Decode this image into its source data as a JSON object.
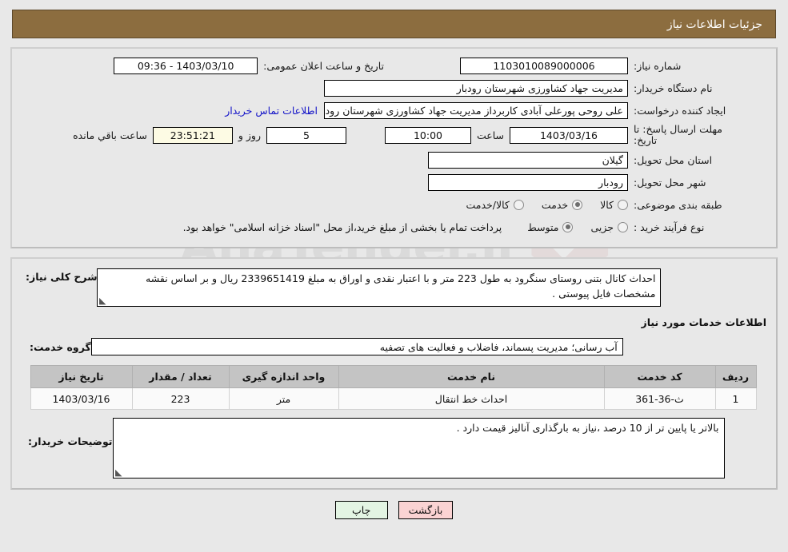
{
  "header": {
    "title": "جزئیات اطلاعات نیاز",
    "bar_color": "#8c6d3f"
  },
  "summary": {
    "need_number_label": "شماره نیاز:",
    "need_number_value": "1103010089000006",
    "public_announce_label": "تاریخ و ساعت اعلان عمومی:",
    "public_announce_value": "1403/03/10 - 09:36",
    "buyer_org_label": "نام دستگاه خریدار:",
    "buyer_org_value": "مدیریت جهاد کشاورزی شهرستان رودبار",
    "creator_label": "ایجاد کننده درخواست:",
    "creator_value": "علی روحی پورعلی آبادی کاربرداز مدیریت جهاد کشاورزی شهرستان رودبار",
    "contact_link": "اطلاعات تماس خریدار",
    "deadline_label_line1": "مهلت ارسال پاسخ: تا",
    "deadline_label_line2": "تاریخ:",
    "deadline_date": "1403/03/16",
    "time_label": "ساعت",
    "deadline_time": "10:00",
    "days_value": "5",
    "days_label": "روز و",
    "countdown_value": "23:51:21",
    "countdown_label": "ساعت باقي مانده",
    "province_label": "استان محل تحویل:",
    "province_value": "گیلان",
    "city_label": "شهر محل تحویل:",
    "city_value": "رودبار",
    "category_label": "طبقه بندی موضوعی:",
    "category_options": [
      {
        "label": "کالا",
        "selected": false
      },
      {
        "label": "خدمت",
        "selected": true
      },
      {
        "label": "کالا/خدمت",
        "selected": false
      }
    ],
    "process_label": "نوع فرآیند خرید :",
    "process_options": [
      {
        "label": "جزیی",
        "selected": false
      },
      {
        "label": "متوسط",
        "selected": true
      }
    ],
    "process_note": "پرداخت تمام یا بخشی از مبلغ خرید،از محل \"اسناد خزانه اسلامی\" خواهد بود."
  },
  "detail": {
    "description_label": "شرح کلی نیاز:",
    "description_value": "احداث کانال بتنی روستای سنگرود به طول 223 متر و با اعتبار نقدی و اوراق به مبلغ 2339651419 ریال و بر اساس نقشه مشخصات فایل پیوستی .",
    "services_section_title": "اطلاعات خدمات مورد نیاز",
    "service_group_label": "گروه خدمت:",
    "service_group_value": "آب رسانی؛ مدیریت پسماند، فاضلاب و فعالیت های تصفیه",
    "table": {
      "columns": [
        "ردیف",
        "کد خدمت",
        "نام خدمت",
        "واحد اندازه گیری",
        "تعداد / مقدار",
        "تاریخ نیاز"
      ],
      "rows": [
        {
          "index": "1",
          "code": "ث-36-361",
          "name": "احداث خط انتقال",
          "unit": "متر",
          "quantity": "223",
          "date": "1403/03/16"
        }
      ]
    },
    "notes_label": "توضیحات خریدار:",
    "notes_value": "بالاتر یا پایین تر از 10 درصد ،نیاز به بارگذاری آنالیز قیمت دارد ."
  },
  "footer": {
    "print_label": "چاپ",
    "back_label": "بازگشت"
  },
  "watermark": {
    "text": "AnaTender.ir"
  }
}
